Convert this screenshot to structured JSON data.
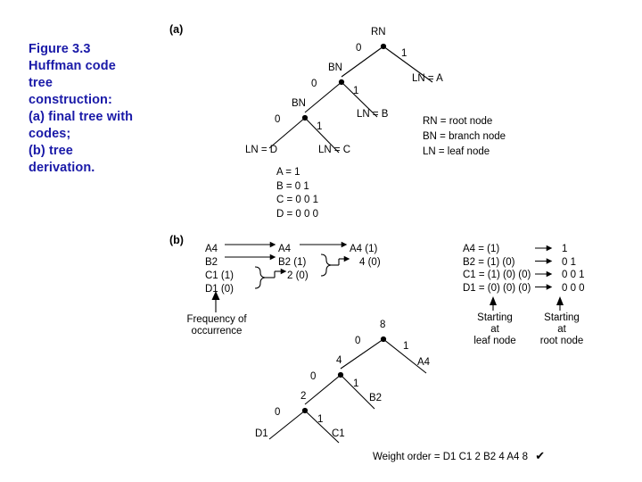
{
  "figure": {
    "caption_lines": [
      "Figure 3.3",
      "Huffman code",
      "tree",
      "construction:",
      "(a) final tree with",
      "codes;",
      "(b) tree",
      "derivation."
    ],
    "caption_color": "#1a1aa8"
  },
  "part_a": {
    "label": "(a)",
    "tree": {
      "root": "RN",
      "nodes": [
        {
          "id": "rn",
          "label": "RN"
        },
        {
          "id": "bn1",
          "label": "BN"
        },
        {
          "id": "bn2",
          "label": "BN"
        },
        {
          "id": "lnA",
          "label": "LN = A"
        },
        {
          "id": "lnB",
          "label": "LN = B"
        },
        {
          "id": "lnC",
          "label": "LN = C"
        },
        {
          "id": "lnD",
          "label": "LN = D"
        }
      ],
      "edge_labels": {
        "e1": "0",
        "e2": "1",
        "e3": "0",
        "e4": "1",
        "e5": "0",
        "e6": "1"
      }
    },
    "legend": [
      "RN  =  root node",
      "BN  =  branch node",
      "LN  =  leaf node"
    ],
    "codes": [
      "A = 1",
      "B = 0 1",
      "C = 0 0 1",
      "D = 0 0 0"
    ]
  },
  "part_b": {
    "label": "(b)",
    "derivation": {
      "col1": [
        "A4",
        "B2",
        "C1 (1)",
        "D1 (0)"
      ],
      "col2": [
        "A4",
        "B2 (1)",
        "2 (0)"
      ],
      "col3": [
        "A4 (1)",
        "4 (0)"
      ],
      "frequency_note": [
        "Frequency of",
        "occurrence"
      ]
    },
    "code_build": {
      "rows": [
        {
          "left": "A4 = (1)",
          "right": "1"
        },
        {
          "left": "B2 = (1) (0)",
          "right": "0 1"
        },
        {
          "left": "C1 = (1) (0) (0)",
          "right": "0 0 1"
        },
        {
          "left": "D1 = (0) (0) (0)",
          "right": "0 0 0"
        }
      ],
      "note_left": [
        "Starting",
        "at",
        "leaf node"
      ],
      "note_right": [
        "Starting",
        "at",
        "root node"
      ]
    },
    "weight_tree": {
      "nodes": [
        {
          "id": "r",
          "label": "8"
        },
        {
          "id": "n4",
          "label": "4"
        },
        {
          "id": "n2",
          "label": "2"
        },
        {
          "id": "a4",
          "label": "A4"
        },
        {
          "id": "b2",
          "label": "B2"
        },
        {
          "id": "c1",
          "label": "C1"
        },
        {
          "id": "d1",
          "label": "D1"
        }
      ],
      "edge_labels": {
        "e1": "0",
        "e2": "1",
        "e3": "0",
        "e4": "1",
        "e5": "0",
        "e6": "1"
      }
    },
    "weight_order": {
      "text": "Weight order = D1  C1  2  B2  4  A4  8",
      "check": "✔"
    }
  }
}
